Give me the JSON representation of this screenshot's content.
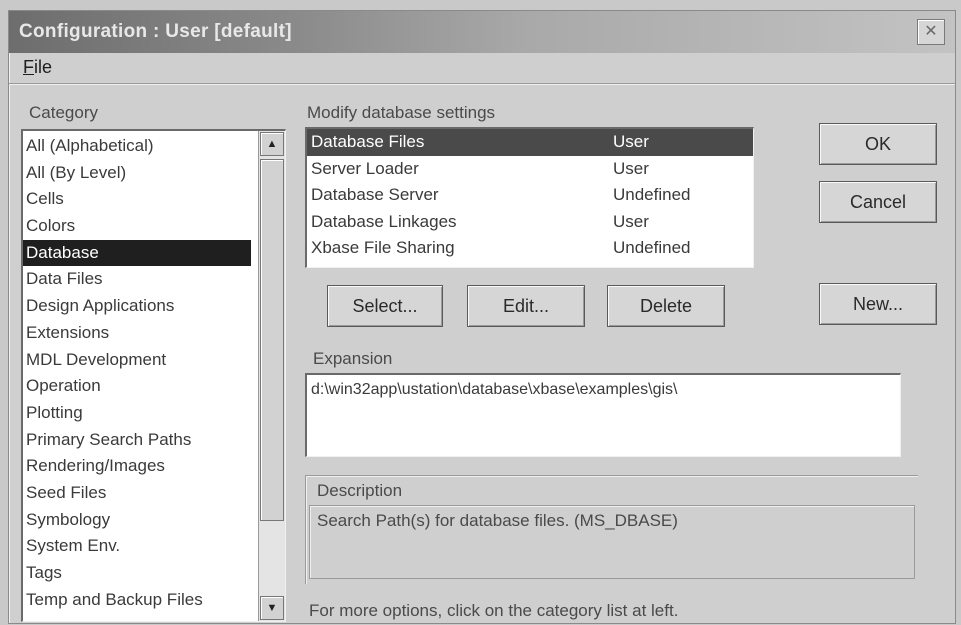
{
  "window": {
    "title": "Configuration : User [default]",
    "close_glyph": "✕"
  },
  "menu": {
    "file_hotkey": "F",
    "file_rest": "ile"
  },
  "category": {
    "label": "Category",
    "items": [
      "All (Alphabetical)",
      "All (By Level)",
      "Cells",
      "Colors",
      "Database",
      "Data Files",
      "Design Applications",
      "Extensions",
      "MDL Development",
      "Operation",
      "Plotting",
      "Primary Search Paths",
      "Rendering/Images",
      "Seed Files",
      "Symbology",
      "System Env.",
      "Tags",
      "Temp and Backup Files"
    ],
    "selected_index": 4,
    "scroll_up_glyph": "▲",
    "scroll_down_glyph": "▼"
  },
  "database": {
    "label": "Modify database settings",
    "rows": [
      {
        "name": "Database Files",
        "value": "User"
      },
      {
        "name": "Server Loader",
        "value": "User"
      },
      {
        "name": "Database Server",
        "value": "Undefined"
      },
      {
        "name": "Database Linkages",
        "value": "User"
      },
      {
        "name": "Xbase File Sharing",
        "value": "Undefined"
      }
    ],
    "selected_index": 0
  },
  "buttons": {
    "ok": "OK",
    "cancel": "Cancel",
    "select": "Select...",
    "edit": "Edit...",
    "delete": "Delete",
    "new": "New..."
  },
  "expansion": {
    "label": "Expansion",
    "value": "d:\\win32app\\ustation\\database\\xbase\\examples\\gis\\"
  },
  "description": {
    "label": "Description",
    "text": "Search Path(s) for database files. (MS_DBASE)"
  },
  "status": {
    "text": "For more options, click on the category list at left."
  },
  "colors": {
    "selection_dark": "#1f1f1f",
    "selection_mid": "#4a4a4a",
    "window_bg": "#cfcfcf"
  }
}
